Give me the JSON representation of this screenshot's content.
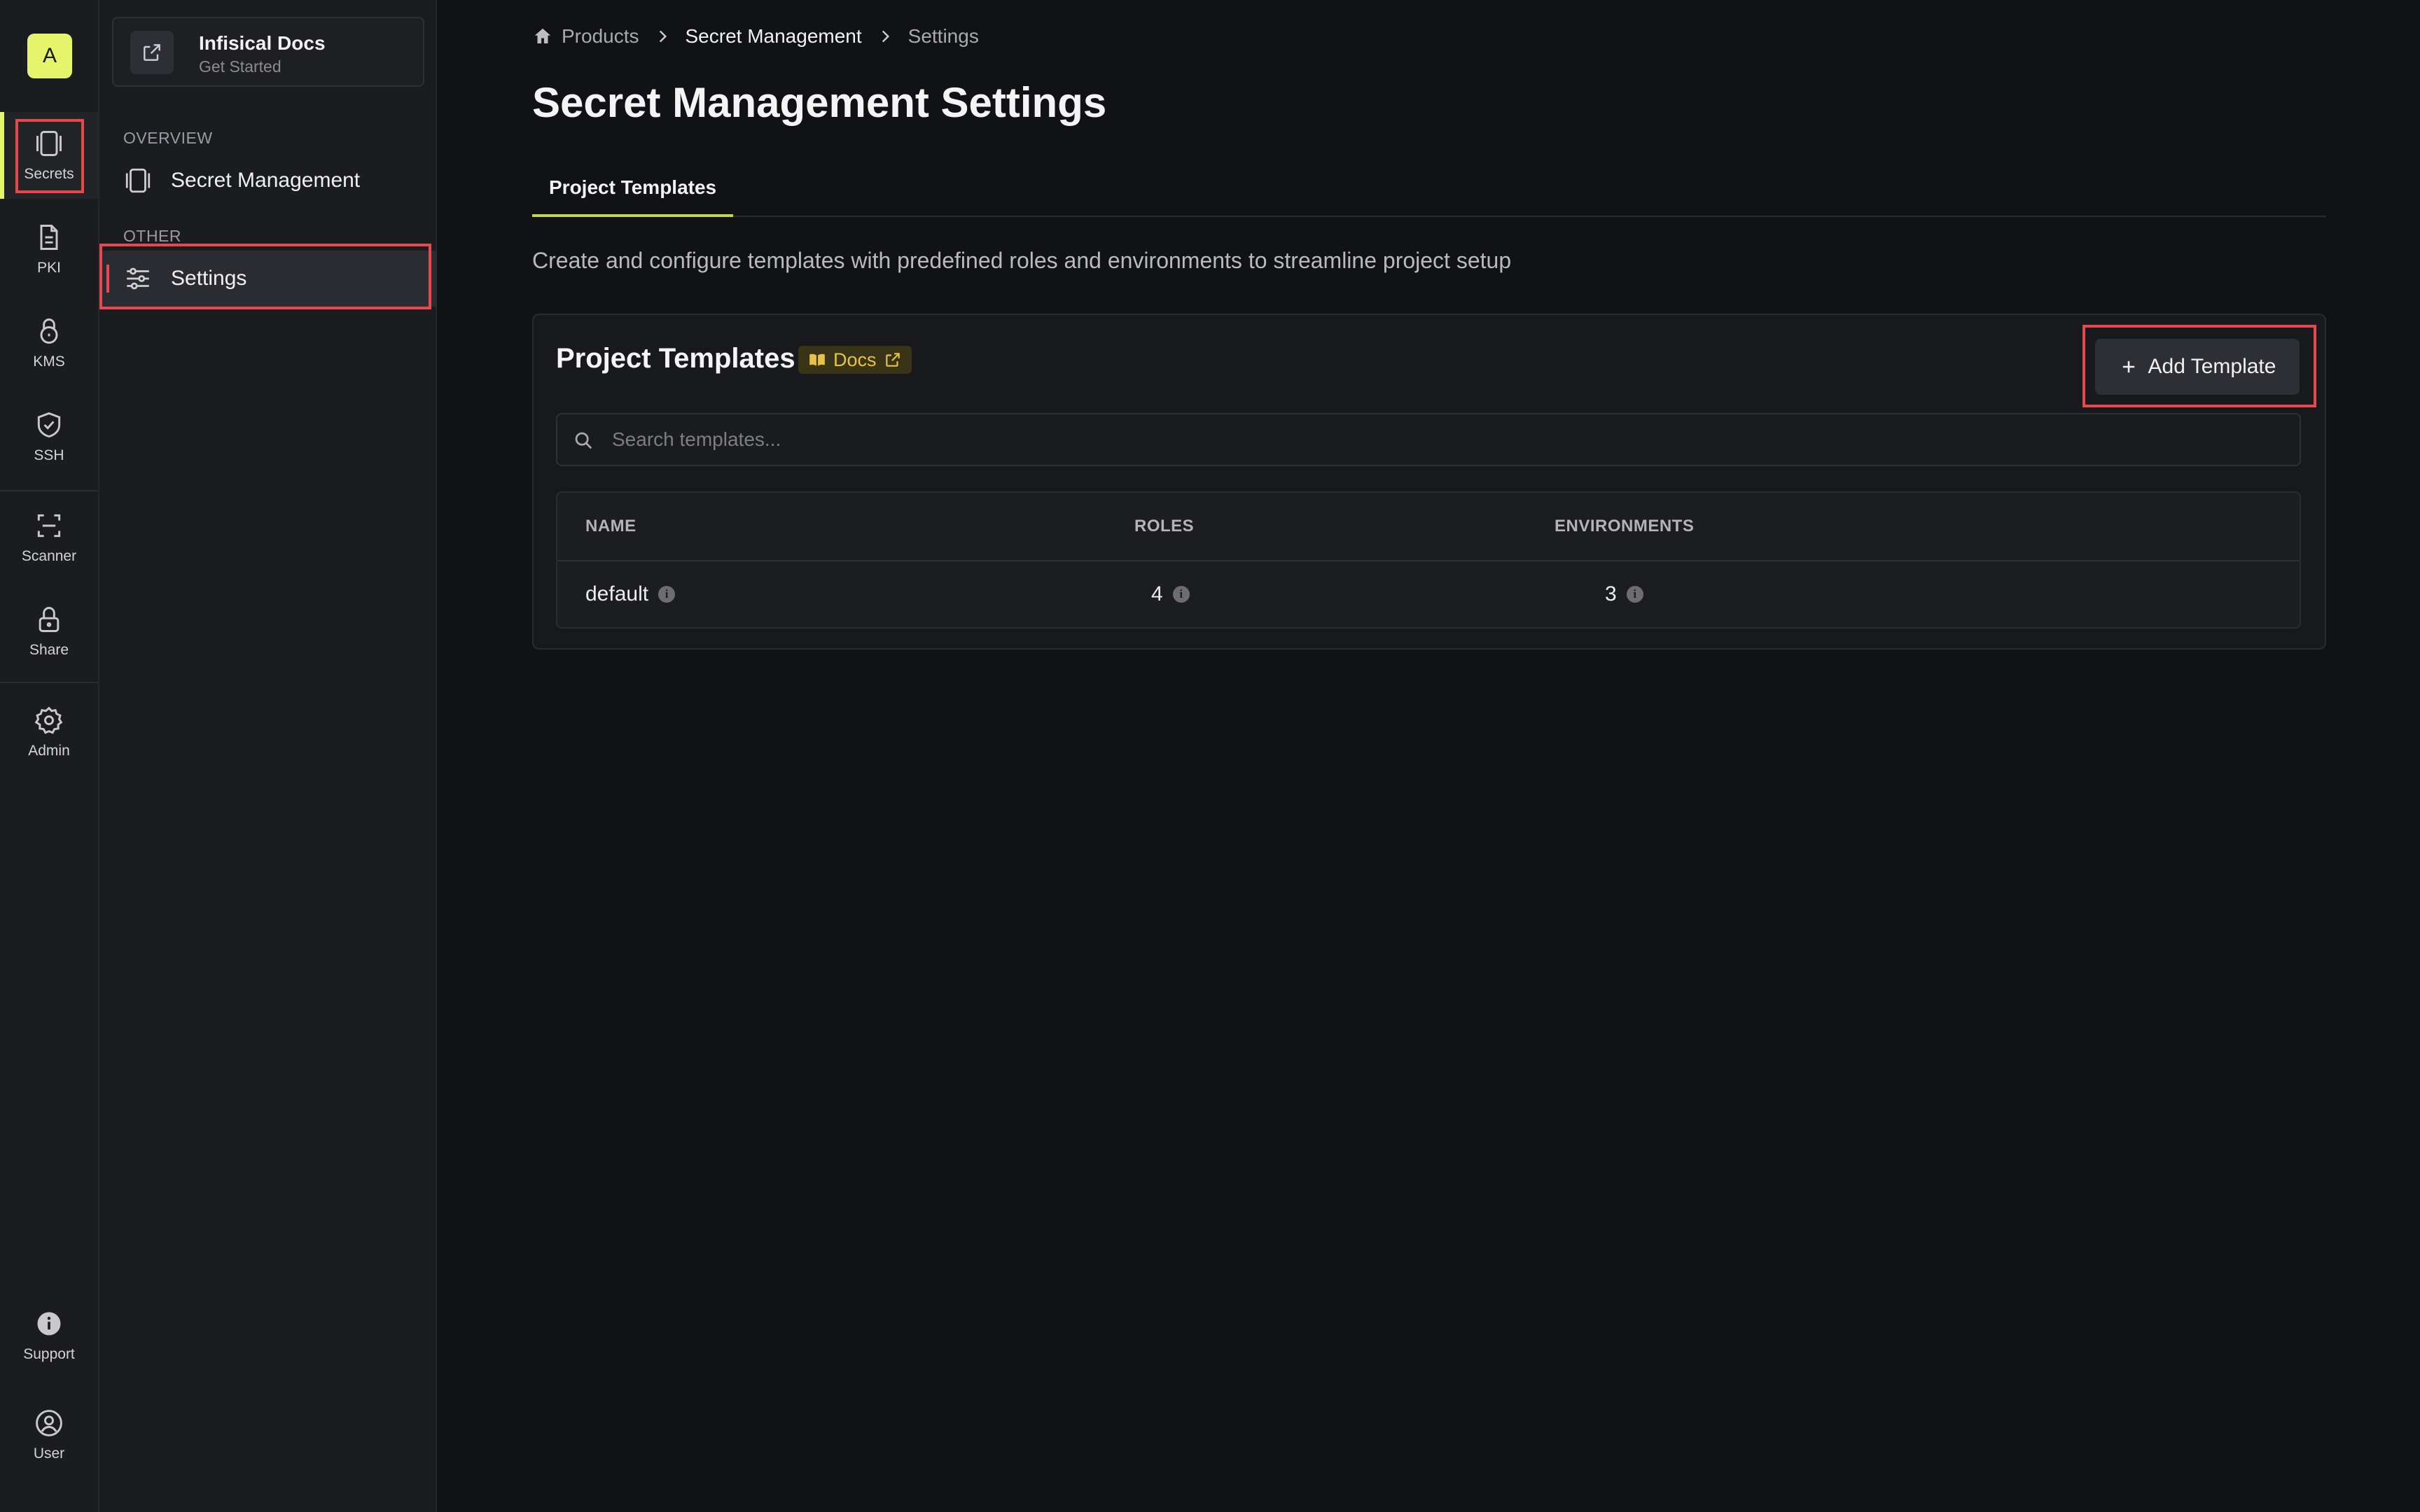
{
  "org": {
    "initial": "A"
  },
  "rail": {
    "items": [
      {
        "label": "Secrets",
        "icon": "secrets-icon"
      },
      {
        "label": "PKI",
        "icon": "document-icon"
      },
      {
        "label": "KMS",
        "icon": "lock-keyhole-icon"
      },
      {
        "label": "SSH",
        "icon": "shield-check-icon"
      },
      {
        "label": "Scanner",
        "icon": "scanner-icon"
      },
      {
        "label": "Share",
        "icon": "lock-icon"
      },
      {
        "label": "Admin",
        "icon": "gear-icon"
      },
      {
        "label": "Support",
        "icon": "info-icon"
      },
      {
        "label": "User",
        "icon": "user-icon"
      }
    ]
  },
  "sidebar": {
    "docs_card": {
      "title": "Infisical Docs",
      "subtitle": "Get Started"
    },
    "sections": [
      {
        "label": "OVERVIEW",
        "items": [
          {
            "label": "Secret Management"
          }
        ]
      },
      {
        "label": "OTHER",
        "items": [
          {
            "label": "Settings"
          }
        ]
      }
    ]
  },
  "breadcrumb": {
    "items": [
      "Products",
      "Secret Management",
      "Settings"
    ]
  },
  "page": {
    "title": "Secret Management Settings",
    "tabs": [
      {
        "label": "Project Templates"
      }
    ],
    "description": "Create and configure templates with predefined roles and environments to streamline project setup"
  },
  "templates_card": {
    "title": "Project Templates",
    "docs_label": "Docs",
    "add_button": "Add Template",
    "search_placeholder": "Search templates...",
    "columns": [
      "NAME",
      "ROLES",
      "ENVIRONMENTS"
    ],
    "rows": [
      {
        "name": "default",
        "roles": "4",
        "environments": "3"
      }
    ]
  },
  "colors": {
    "accent": "#e4f56b",
    "highlight": "#e5484d",
    "docs_badge": "#e7c24a"
  }
}
